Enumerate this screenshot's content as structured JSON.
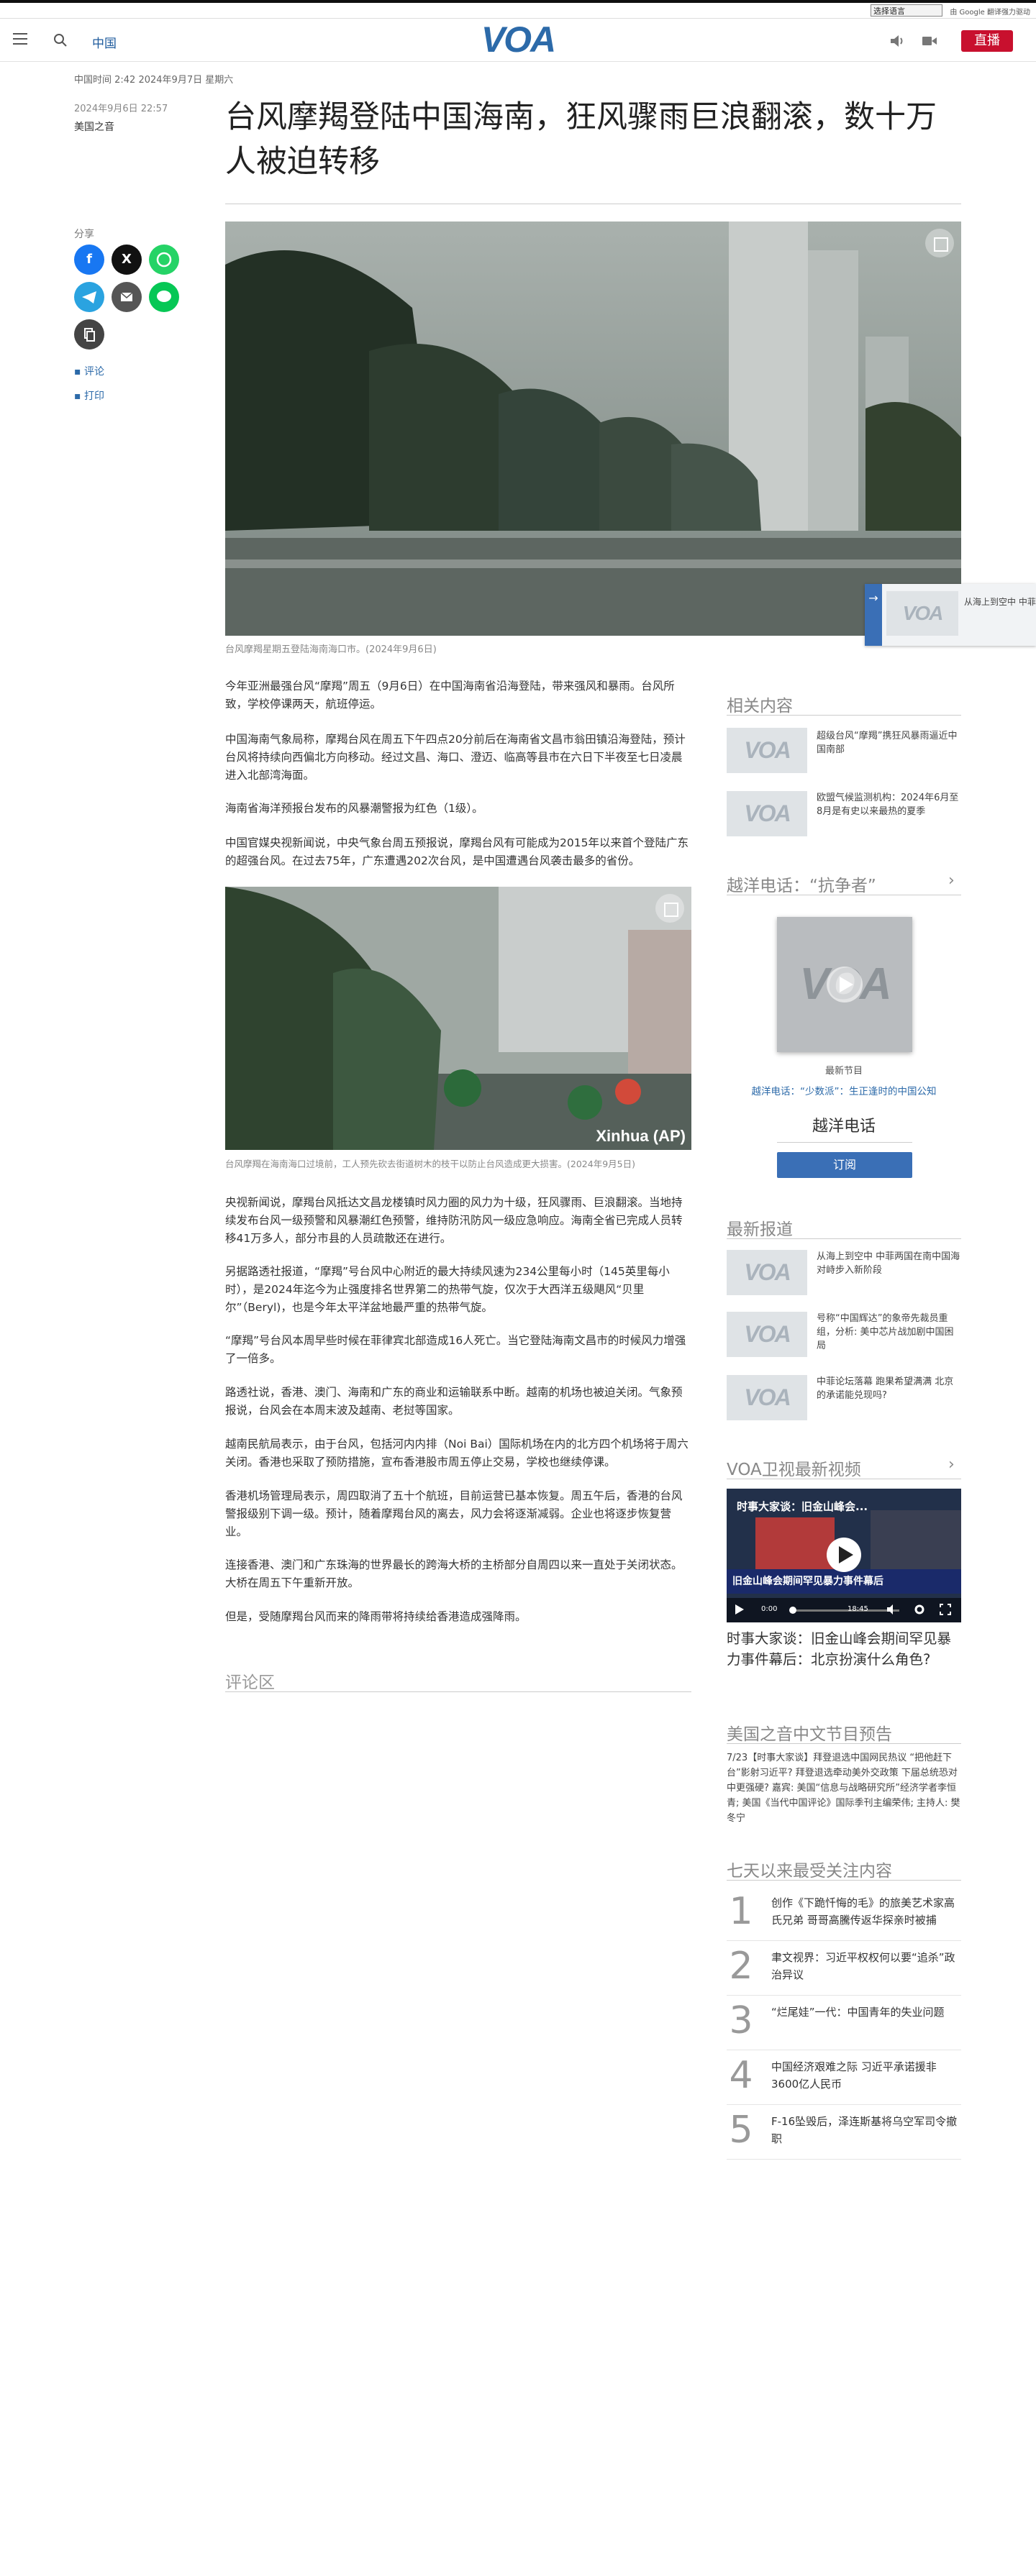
{
  "topbar": {
    "language_select": "选择语言",
    "translate_note": "由 Google 翻译强力驱动"
  },
  "header": {
    "region": "中国",
    "logo": "VOA",
    "live": "直播"
  },
  "article": {
    "datetime": "中国时间 2:42 2024年9月7日 星期六",
    "pub_date": "2024年9月6日 22:57",
    "byline": "美国之音",
    "title": "台风摩羯登陆中国海南，狂风骤雨巨浪翻滚，数十万人被迫转移",
    "share_label": "分享",
    "comment_label": "评论",
    "print_label": "打印",
    "hero_caption": "台风摩羯星期五登陆海南海口市。(2024年9月6日)",
    "paragraphs_1": [
      "今年亚洲最强台风“摩羯”周五（9月6日）在中国海南省沿海登陆，带来强风和暴雨。台风所致，学校停课两天，航班停运。",
      "中国海南气象局称，摩羯台风在周五下午四点20分前后在海南省文昌市翁田镇沿海登陆，预计台风将持续向西偏北方向移动。经过文昌、海口、澄迈、临高等县市在六日下半夜至七日凌晨进入北部湾海面。",
      "海南省海洋预报台发布的风暴潮警报为红色（1级）。",
      "中国官媒央视新闻说，中央气象台周五预报说，摩羯台风有可能成为2015年以来首个登陆广东的超强台风。在过去75年，广东遭遇202次台风，是中国遭遇台风袭击最多的省份。"
    ],
    "image2_caption": "台风摩羯在海南海口过境前，工人预先砍去街道树木的枝干以防止台风造成更大损害。(2024年9月5日)",
    "image2_credit": "Xinhua (AP)",
    "paragraphs_2": [
      "央视新闻说，摩羯台风抵达文昌龙楼镇时风力圈的风力为十级，狂风骤雨、巨浪翻滚。当地持续发布台风一级预警和风暴潮红色预警，维持防汛防风一级应急响应。海南全省已完成人员转移41万多人，部分市县的人员疏散还在进行。",
      "另据路透社报道，“摩羯”号台风中心附近的最大持续风速为234公里每小时（145英里每小时），是2024年迄今为止强度排名世界第二的热带气旋，仅次于大西洋五级飓风“贝里尔”（Beryl)，也是今年太平洋盆地最严重的热带气旋。",
      "“摩羯”号台风本周早些时候在菲律宾北部造成16人死亡。当它登陆海南文昌市的时候风力增强了一倍多。",
      "路透社说，香港、澳门、海南和广东的商业和运输联系中断。越南的机场也被迫关闭。气象预报说，台风会在本周末波及越南、老挝等国家。",
      "越南民航局表示，由于台风，包括河内内排（Noi Bai）国际机场在内的北方四个机场将于周六关闭。香港也采取了预防措施，宣布香港股市周五停止交易，学校也继续停课。",
      "香港机场管理局表示，周四取消了五十个航班，目前运营已基本恢复。周五午后，香港的台风警报级别下调一级。预计，随着摩羯台风的离去，风力会将逐渐减弱。企业也将逐步恢复营业。",
      "连接香港、澳门和广东珠海的世界最长的跨海大桥的主桥部分自周四以来一直处于关闭状态。大桥在周五下午重新开放。",
      "但是，受随摩羯台风而来的降雨带将持续给香港造成强降雨。"
    ],
    "comments_heading": "评论区"
  },
  "sidebar": {
    "related_heading": "相关内容",
    "related": [
      {
        "title": "超级台风“摩羯”携狂风暴雨逼近中国南部"
      },
      {
        "title": "欧盟气候监测机构：2024年6月至8月是有史以来最热的夏季"
      }
    ],
    "podcast_heading": "越洋电话：“抗争者”",
    "podcast_latest_label": "最新节目",
    "podcast_latest_episode": "越洋电话：“少数派”：生正逢时的中国公知",
    "podcast_name": "越洋电话",
    "subscribe": "订阅",
    "latest_heading": "最新报道",
    "latest": [
      {
        "title": "从海上到空中 中菲两国在南中国海对峙步入新阶段"
      },
      {
        "title": "号称“中国辉达”的象帝先裁员重组，分析: 美中芯片战加剧中国困局"
      },
      {
        "title": "中菲论坛落幕 跑果希望满满 北京的承诺能兑现吗?"
      }
    ],
    "video_heading": "VOA卫视最新视频",
    "video": {
      "overlay_title": "时事大家谈：旧金山峰会...",
      "banner_text": "旧金山峰会期间罕见暴力事件幕后",
      "time_current": "0:00",
      "time_total": "18:45",
      "title": "时事大家谈：旧金山峰会期间罕见暴力事件幕后：北京扮演什么角色?"
    },
    "schedule_heading": "美国之音中文节目预告",
    "schedule_text": "7/23【时事大家谈】拜登退选中国网民热议 “把他赶下台”影射习近平? 拜登退选牵动美外交政策 下届总统恐对中更强硬? 嘉宾: 美国“信息与战略研究所”经济学者李恒青; 美国《当代中国评论》国际季刊主编荣伟; 主持人: 樊冬宁",
    "popular_heading": "七天以来最受关注内容",
    "popular": [
      {
        "rank": "1",
        "title": "创作《下跪忏悔的毛》的旅美艺术家高氏兄弟 哥哥高騰传返华探亲时被捕"
      },
      {
        "rank": "2",
        "title": "聿文视界：习近平权权何以要“追杀”政治异议"
      },
      {
        "rank": "3",
        "title": "“烂尾娃”一代：中国青年的失业问题"
      },
      {
        "rank": "4",
        "title": "中国经济艰难之际 习近平承诺援非3600亿人民币"
      },
      {
        "rank": "5",
        "title": "F-16坠毁后，泽连斯基将乌空军司令撤职"
      }
    ]
  },
  "popup": {
    "text": "从海上到空中 中菲两国在南中国海对峙步入新阶段"
  },
  "colors": {
    "brand": "#2c6aa9",
    "live": "#c8102e",
    "subscribe": "#3a6fb6"
  }
}
